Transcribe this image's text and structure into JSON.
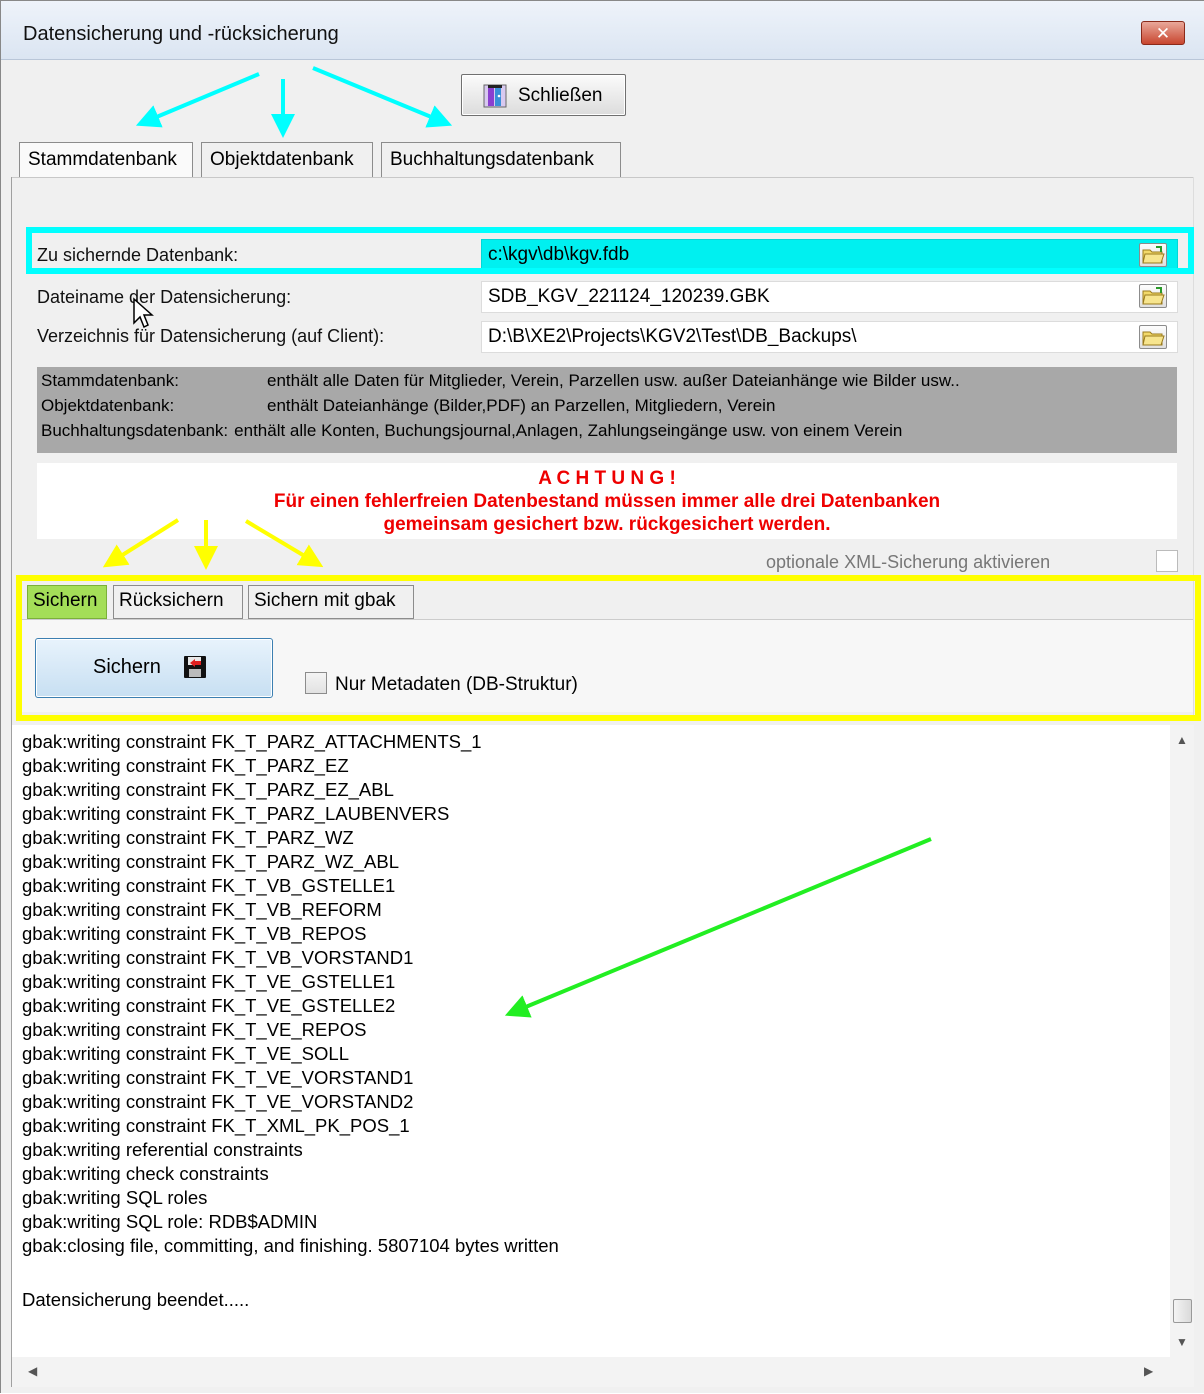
{
  "window": {
    "title": "Datensicherung und -rücksicherung",
    "close_glyph": "✕"
  },
  "toolbar": {
    "close_label": "Schließen"
  },
  "db_tabs": [
    {
      "label": "Stammdatenbank",
      "active": true
    },
    {
      "label": "Objektdatenbank",
      "active": false
    },
    {
      "label": "Buchhaltungsdatenbank",
      "active": false
    }
  ],
  "fields": {
    "database": {
      "label": "Zu sichernde Datenbank:",
      "value": "c:\\kgv\\db\\kgv.fdb"
    },
    "backup_file": {
      "label": "Dateiname der Datensicherung:",
      "value": "SDB_KGV_221124_120239.GBK"
    },
    "backup_dir": {
      "label": "Verzeichnis für Datensicherung   (auf Client):",
      "value": "D:\\B\\XE2\\Projects\\KGV2\\Test\\DB_Backups\\"
    }
  },
  "info": [
    {
      "key": "Stammdatenbank:",
      "text": "enthält alle Daten für Mitglieder, Verein, Parzellen usw. außer Dateianhänge wie Bilder usw.."
    },
    {
      "key": "Objektdatenbank:",
      "text": "enthält Dateianhänge (Bilder,PDF) an Parzellen, Mitgliedern, Verein"
    },
    {
      "key": "Buchhaltungsdatenbank:",
      "text": "enthält alle Konten, Buchungsjournal,Anlagen, Zahlungseingänge usw. von einem Verein"
    }
  ],
  "warning": {
    "title": "A C H T U N G !",
    "line1": "Für einen fehlerfreien Datenbestand müssen immer alle drei Datenbanken",
    "line2": "gemeinsam gesichert bzw. rückgesichert werden."
  },
  "xml_option": {
    "label": "optionale XML-Sicherung aktivieren",
    "checked": false
  },
  "op_tabs": [
    {
      "label": "Sichern",
      "active": true
    },
    {
      "label": "Rücksichern",
      "active": false
    },
    {
      "label": "Sichern mit gbak",
      "active": false
    }
  ],
  "actions": {
    "save_label": "Sichern",
    "metadata_only_label": "Nur Metadaten (DB-Struktur)",
    "metadata_only_checked": false
  },
  "log_lines": [
    "gbak:writing constraint FK_T_PARZ_ATTACHMENTS_1",
    "gbak:writing constraint FK_T_PARZ_EZ",
    "gbak:writing constraint FK_T_PARZ_EZ_ABL",
    "gbak:writing constraint FK_T_PARZ_LAUBENVERS",
    "gbak:writing constraint FK_T_PARZ_WZ",
    "gbak:writing constraint FK_T_PARZ_WZ_ABL",
    "gbak:writing constraint FK_T_VB_GSTELLE1",
    "gbak:writing constraint FK_T_VB_REFORM",
    "gbak:writing constraint FK_T_VB_REPOS",
    "gbak:writing constraint FK_T_VB_VORSTAND1",
    "gbak:writing constraint FK_T_VE_GSTELLE1",
    "gbak:writing constraint FK_T_VE_GSTELLE2",
    "gbak:writing constraint FK_T_VE_REPOS",
    "gbak:writing constraint FK_T_VE_SOLL",
    "gbak:writing constraint FK_T_VE_VORSTAND1",
    "gbak:writing constraint FK_T_VE_VORSTAND2",
    "gbak:writing constraint FK_T_XML_PK_POS_1",
    "gbak:writing referential constraints",
    "gbak:writing check constraints",
    "gbak:writing SQL roles",
    "gbak:writing SQL role: RDB$ADMIN",
    "gbak:closing file, committing, and finishing. 5807104 bytes written",
    "",
    "Datensicherung beendet....."
  ],
  "annotation_colors": {
    "cyan": "#00ffff",
    "yellow": "#ffff00",
    "green": "#22ee22",
    "warning_red": "#ee0000",
    "active_tab_green": "#a4de58"
  },
  "icons": {
    "close": "exit-door-icon",
    "folder": "folder-icon",
    "save": "floppy-disk-icon"
  }
}
